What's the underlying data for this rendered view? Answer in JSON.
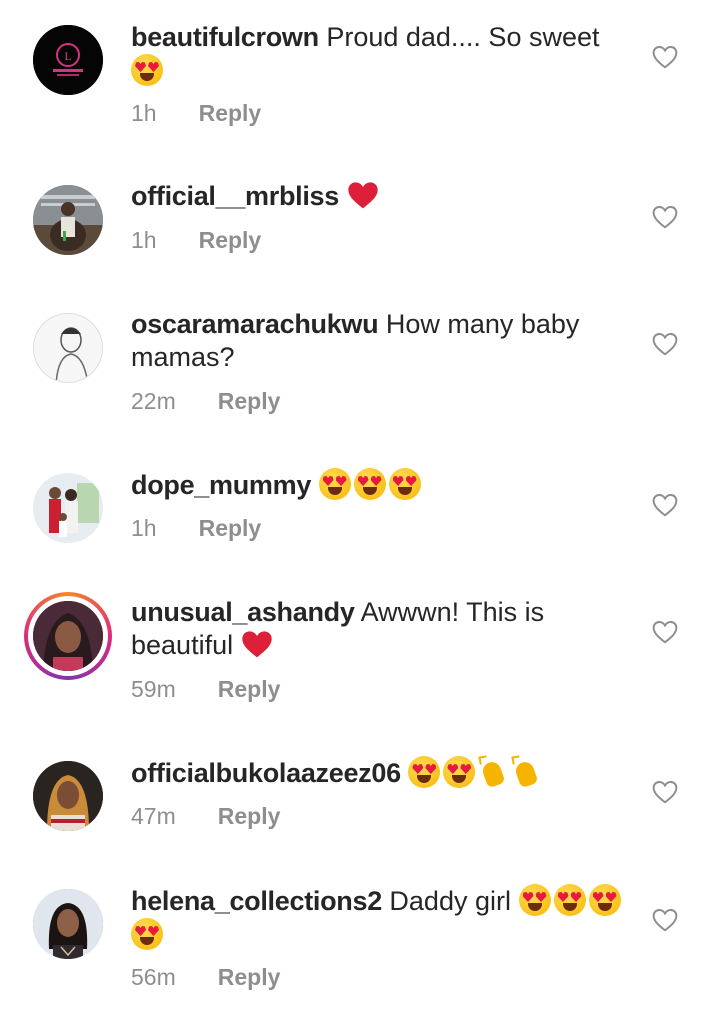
{
  "comments": [
    {
      "username": "beautifulcrown",
      "text": "Proud dad.... So sweet",
      "time": "1h",
      "reply": "Reply",
      "avatar": "beautifulcrown-logo"
    },
    {
      "username": "official__mrbliss",
      "text": "",
      "time": "1h",
      "reply": "Reply",
      "avatar": "man-sitting-photo"
    },
    {
      "username": "oscaramarachukwu",
      "text": "How many baby mamas?",
      "time": "22m",
      "reply": "Reply",
      "avatar": "sketch-portrait"
    },
    {
      "username": "dope_mummy",
      "text": "",
      "time": "1h",
      "reply": "Reply",
      "avatar": "family-photo"
    },
    {
      "username": "unusual_ashandy",
      "text": "Awwwn! This is beautiful",
      "time": "59m",
      "reply": "Reply",
      "avatar": "woman-portrait-story-ring"
    },
    {
      "username": "officialbukolaazeez06",
      "text": "",
      "time": "47m",
      "reply": "Reply",
      "avatar": "woman-portrait"
    },
    {
      "username": "helena_collections2",
      "text": "Daddy girl",
      "time": "56m",
      "reply": "Reply",
      "avatar": "woman-portrait-2"
    }
  ],
  "icons": {
    "like": "heart-outline-icon",
    "heart_emoji": "red-heart-emoji",
    "heart_eyes": "heart-eyes-emoji",
    "clap": "clapping-hands-emoji"
  },
  "colors": {
    "username": "#262626",
    "meta": "#8e8e8e",
    "red_heart": "#e0245e"
  }
}
